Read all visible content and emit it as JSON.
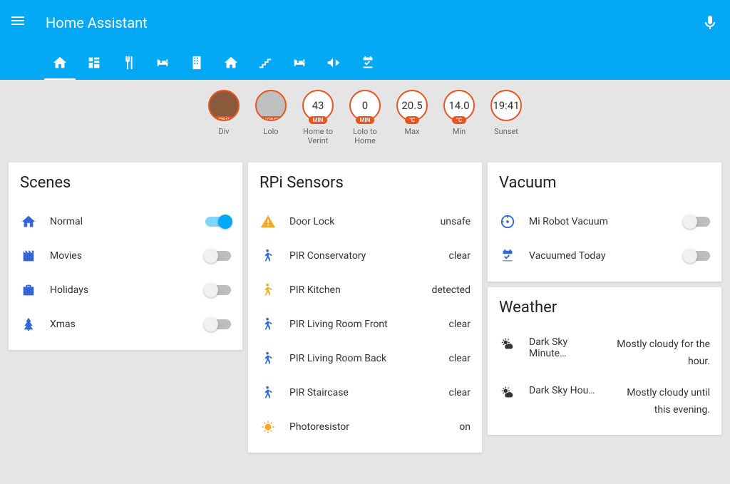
{
  "header": {
    "title": "Home Assistant"
  },
  "badges": [
    {
      "label": "Div",
      "pill": "CBC",
      "avatar": true
    },
    {
      "label": "Lolo",
      "pill": "HOME",
      "avatar": true
    },
    {
      "label": "Home to Verint",
      "value": "43",
      "unit": "MIN"
    },
    {
      "label": "Lolo to Home",
      "value": "0",
      "unit": "MIN"
    },
    {
      "label": "Max",
      "value": "20.5",
      "unit": "°C"
    },
    {
      "label": "Min",
      "value": "14.0",
      "unit": "°C"
    },
    {
      "label": "Sunset",
      "value": "19:41"
    }
  ],
  "scenes": {
    "title": "Scenes",
    "rows": [
      {
        "label": "Normal",
        "on": true
      },
      {
        "label": "Movies",
        "on": false
      },
      {
        "label": "Holidays",
        "on": false
      },
      {
        "label": "Xmas",
        "on": false
      }
    ]
  },
  "sensors": {
    "title": "RPi Sensors",
    "rows": [
      {
        "label": "Door Lock",
        "state": "unsafe"
      },
      {
        "label": "PIR Conservatory",
        "state": "clear"
      },
      {
        "label": "PIR Kitchen",
        "state": "detected"
      },
      {
        "label": "PIR Living Room Front",
        "state": "clear"
      },
      {
        "label": "PIR Living Room Back",
        "state": "clear"
      },
      {
        "label": "PIR Staircase",
        "state": "clear"
      },
      {
        "label": "Photoresistor",
        "state": "on"
      }
    ]
  },
  "vacuum": {
    "title": "Vacuum",
    "rows": [
      {
        "label": "Mi Robot Vacuum",
        "on": false
      },
      {
        "label": "Vacuumed Today",
        "on": false
      }
    ]
  },
  "weather": {
    "title": "Weather",
    "rows": [
      {
        "label": "Dark Sky Minute…",
        "state": "Mostly cloudy for the hour."
      },
      {
        "label": "Dark Sky Hou…",
        "state": "Mostly cloudy until this evening."
      }
    ]
  }
}
